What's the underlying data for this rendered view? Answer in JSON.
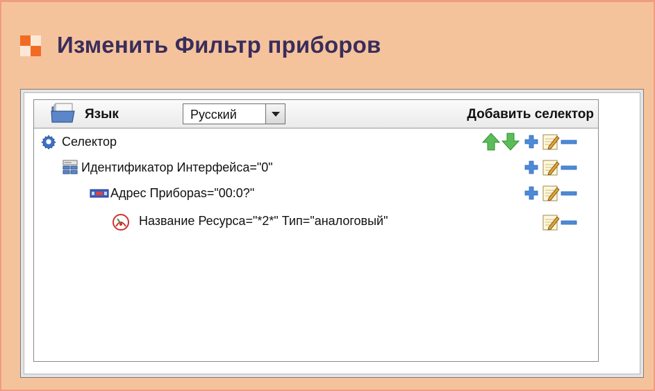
{
  "header": {
    "title": "Изменить Фильтр приборов"
  },
  "toolbar": {
    "language_label": "Язык",
    "language_value": "Русский",
    "add_selector_label": "Добавить селектор"
  },
  "tree": [
    {
      "label": "Селектор",
      "icon": "gear-icon",
      "actions": [
        "move-up-icon",
        "move-down-icon",
        "add-icon",
        "edit-icon",
        "remove-icon"
      ]
    },
    {
      "label": "Идентификатор Интерфейса=\"0\"",
      "icon": "network-interface-icon",
      "actions": [
        "add-icon",
        "edit-icon",
        "remove-icon"
      ]
    },
    {
      "label": "Адрес Приборas=\"00:0?\"",
      "icon": "device-address-icon",
      "actions": [
        "add-icon",
        "edit-icon",
        "remove-icon"
      ]
    },
    {
      "label": "Название Ресурса=\"*2*\" Тип=\"аналоговый\"",
      "icon": "analog-resource-icon",
      "actions": [
        "edit-icon",
        "remove-icon"
      ]
    }
  ],
  "colors": {
    "background": "#f5c39b",
    "title": "#3a2d5c",
    "accent_orange": "#f26b24",
    "arrow_green": "#5bbd5a",
    "plus_blue": "#4d8ad9"
  }
}
